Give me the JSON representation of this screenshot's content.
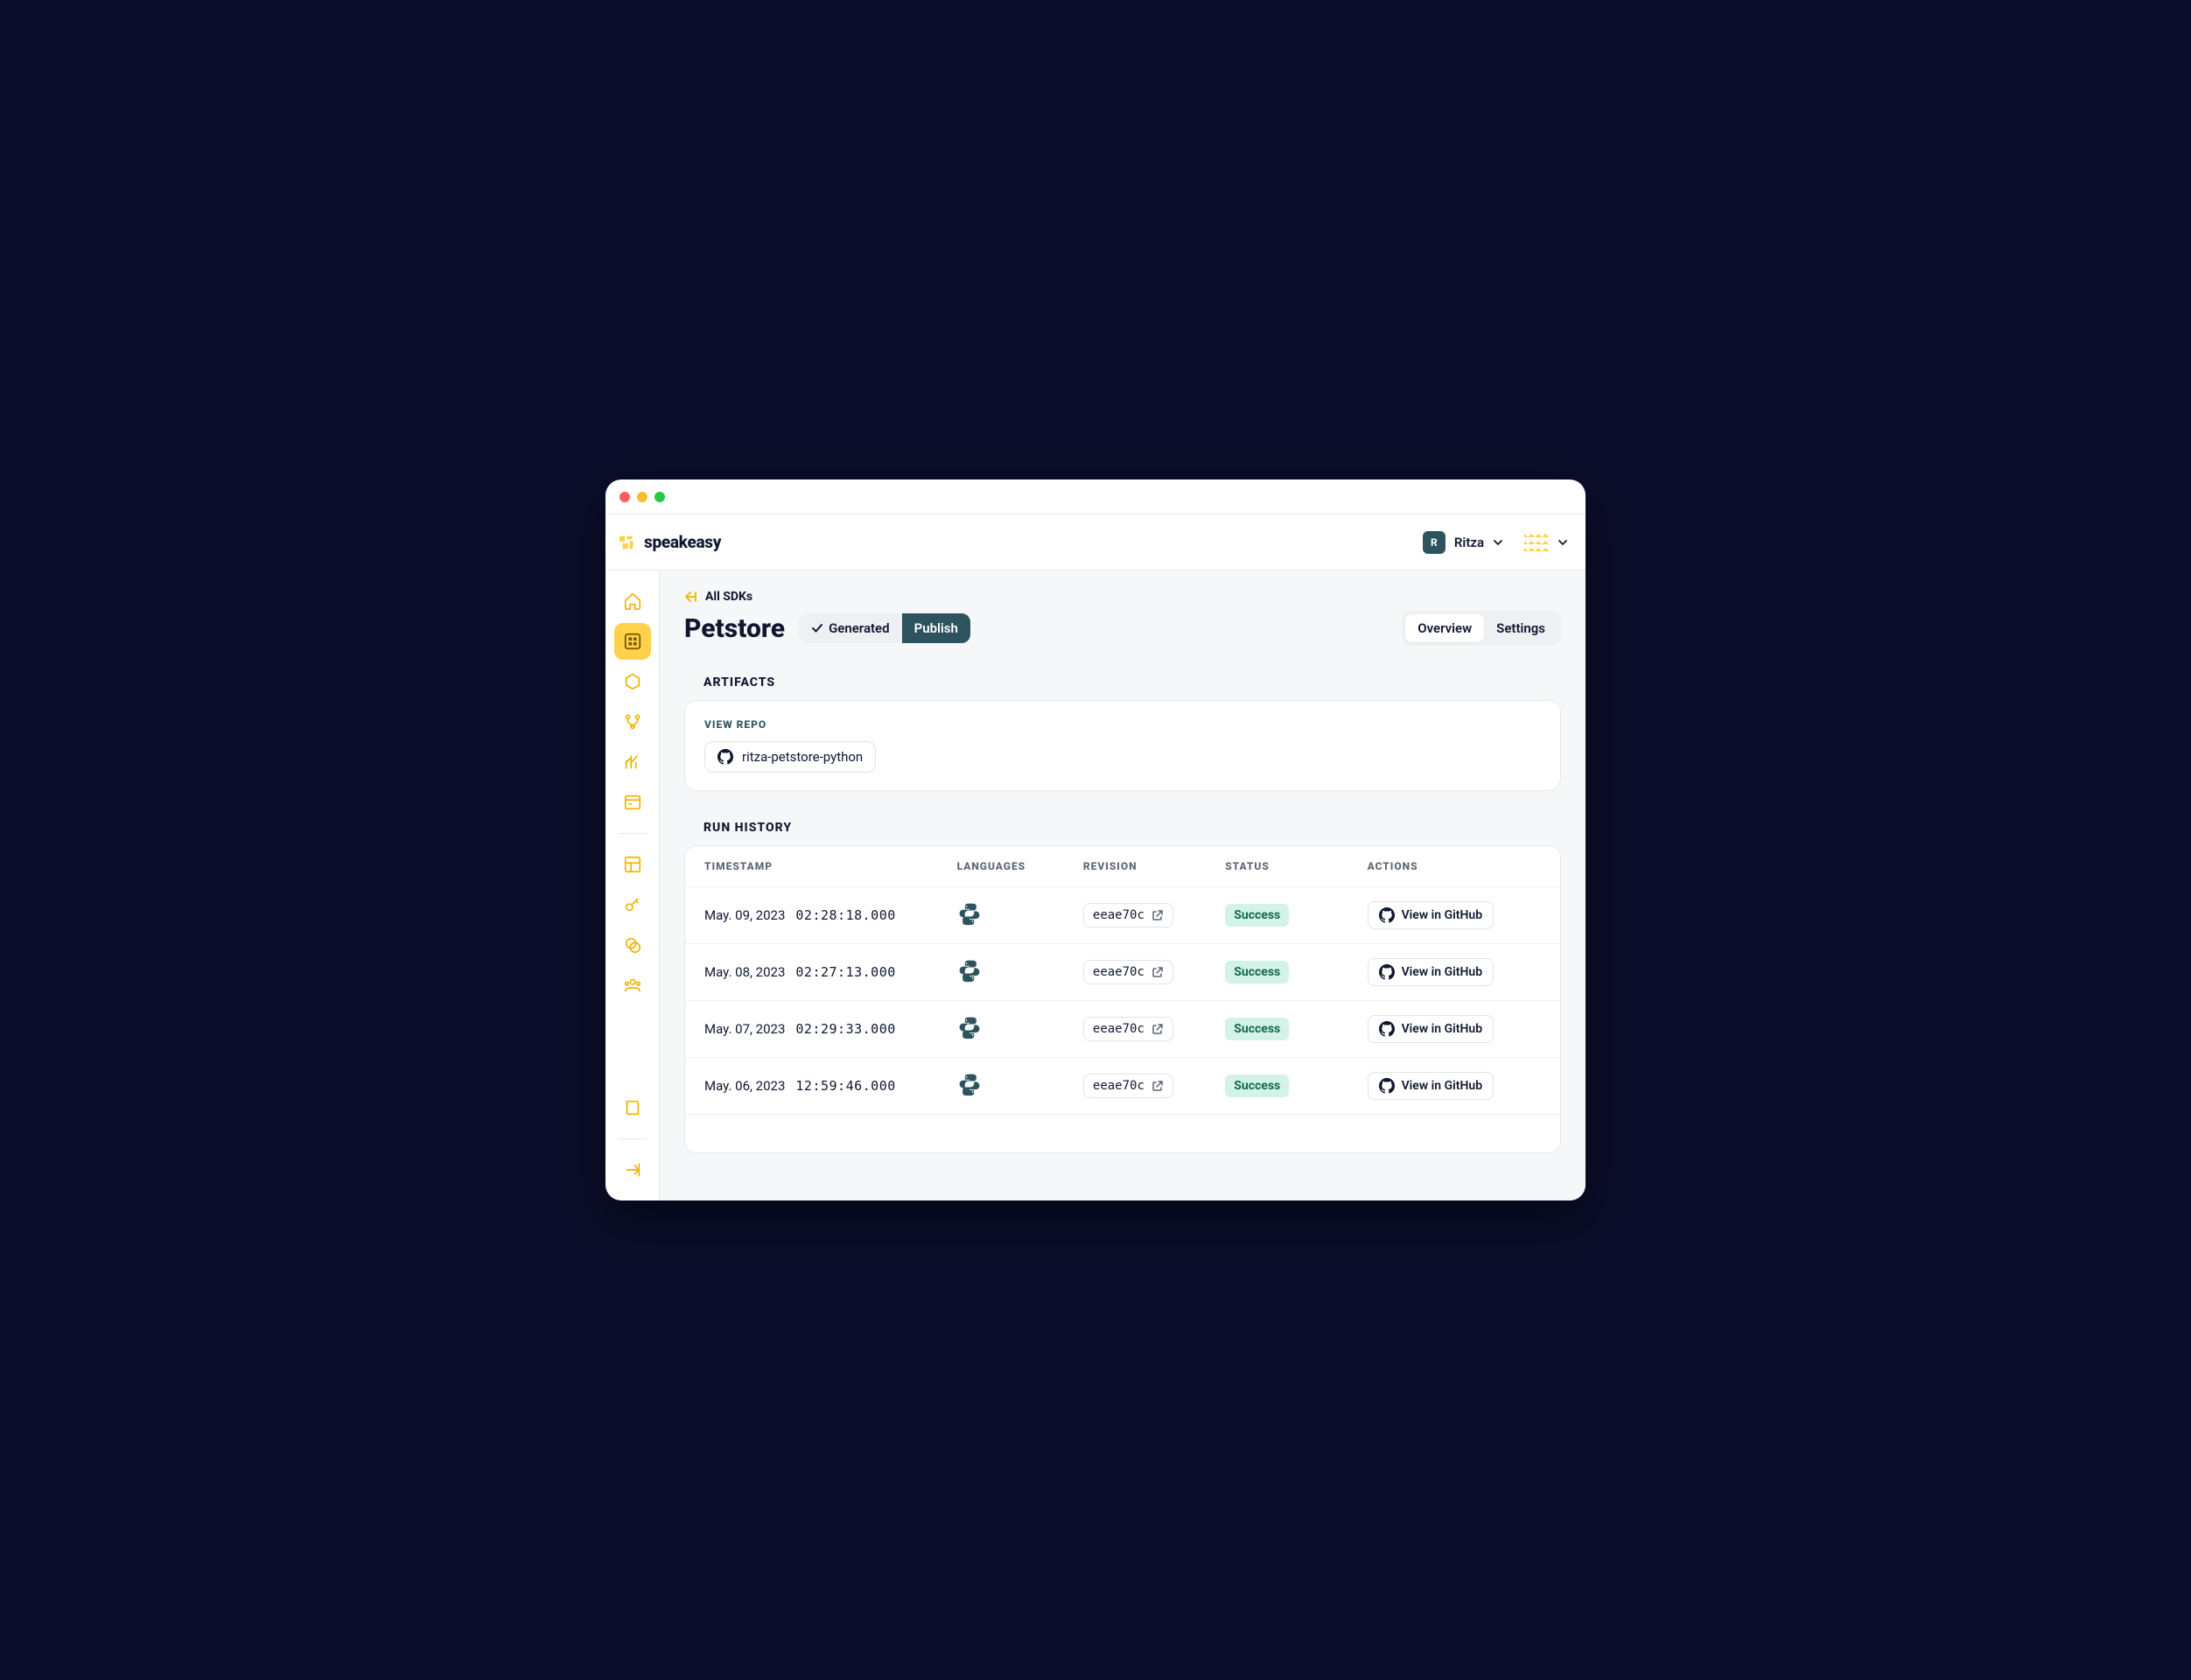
{
  "brand": {
    "name": "speakeasy"
  },
  "org": {
    "badge": "R",
    "name": "Ritza"
  },
  "breadcrumb": {
    "back_label": "All SDKs"
  },
  "page": {
    "title": "Petstore"
  },
  "status_pills": {
    "generated": "Generated",
    "publish": "Publish"
  },
  "tabs": {
    "overview": "Overview",
    "settings": "Settings"
  },
  "artifacts": {
    "section_label": "ARTIFACTS",
    "view_repo_label": "VIEW REPO",
    "repo_name": "ritza-petstore-python"
  },
  "history": {
    "section_label": "RUN HISTORY",
    "columns": {
      "timestamp": "TIMESTAMP",
      "languages": "LANGUAGES",
      "revision": "REVISION",
      "status": "STATUS",
      "actions": "ACTIONS"
    },
    "action_label": "View in GitHub",
    "rows": [
      {
        "date": "May. 09, 2023",
        "time": "02:28:18.000",
        "revision": "eeae70c",
        "status": "Success"
      },
      {
        "date": "May. 08, 2023",
        "time": "02:27:13.000",
        "revision": "eeae70c",
        "status": "Success"
      },
      {
        "date": "May. 07, 2023",
        "time": "02:29:33.000",
        "revision": "eeae70c",
        "status": "Success"
      },
      {
        "date": "May. 06, 2023",
        "time": "12:59:46.000",
        "revision": "eeae70c",
        "status": "Success"
      }
    ]
  }
}
